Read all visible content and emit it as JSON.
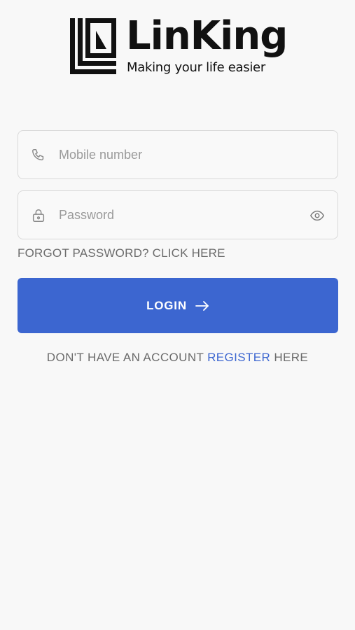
{
  "brand": {
    "name": "LinKing",
    "tagline": "Making your life easier"
  },
  "form": {
    "mobile": {
      "placeholder": "Mobile number",
      "value": "",
      "icon": "phone-icon"
    },
    "password": {
      "placeholder": "Password",
      "value": "",
      "icon": "lock-icon",
      "toggle_icon": "eye-icon"
    },
    "forgot_text": "FORGOT PASSWORD? CLICK HERE",
    "login_label": "LOGIN",
    "login_icon": "arrow-right-icon"
  },
  "register": {
    "prefix": "DON'T HAVE AN ACCOUNT ",
    "link": "REGISTER",
    "suffix": " HERE"
  },
  "colors": {
    "accent": "#3c66d0",
    "background": "#f8f8f8",
    "muted_text": "#6b6b6b",
    "placeholder": "#9a9a9a"
  }
}
